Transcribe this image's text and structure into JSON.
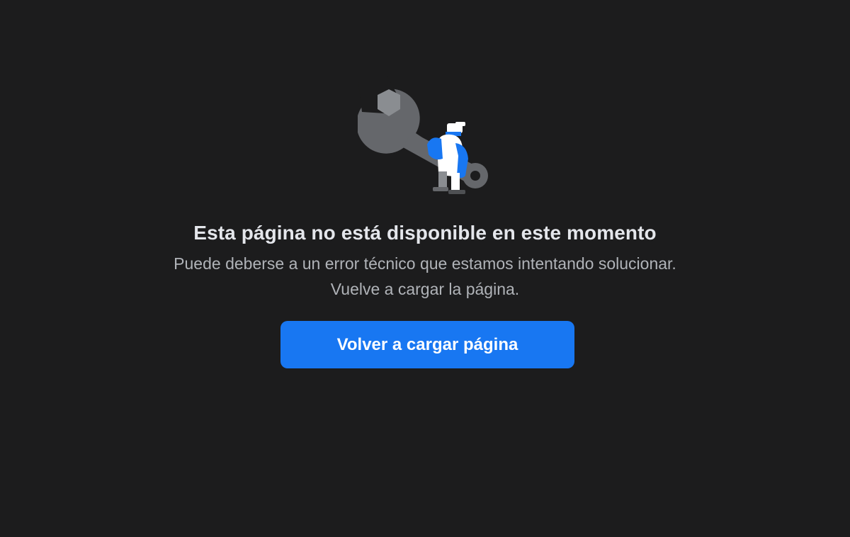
{
  "error_page": {
    "illustration_icon": "wrench-worker-illustration",
    "title": "Esta página no está disponible en este momento",
    "description": "Puede deberse a un error técnico que estamos intentando solucionar. Vuelve a cargar la página.",
    "reload_button_label": "Volver a cargar página"
  },
  "colors": {
    "background": "#1c1c1d",
    "title_text": "#e4e6eb",
    "description_text": "#b0b3b8",
    "button_background": "#1877f2",
    "button_text": "#ffffff",
    "wrench": "#65676b",
    "nut": "#8a8d91",
    "worker_blue": "#1877f2"
  }
}
